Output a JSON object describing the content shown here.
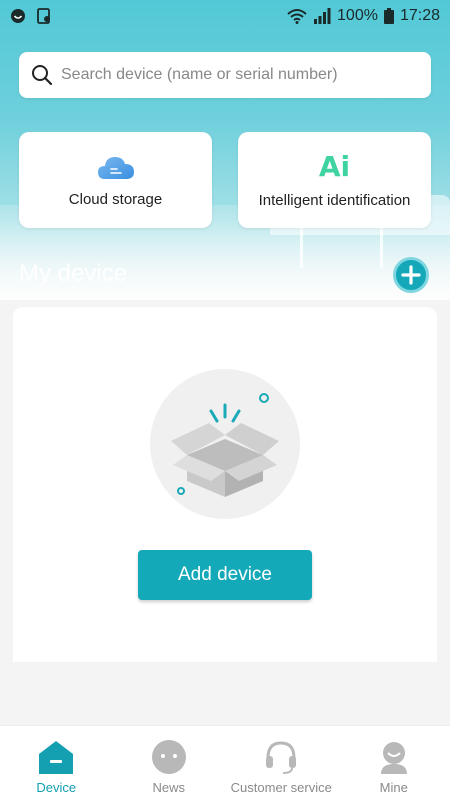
{
  "status_bar": {
    "battery": "100%",
    "time": "17:28",
    "icons": [
      "app-icon",
      "screenshot-icon",
      "wifi-icon",
      "signal-icon",
      "battery-icon"
    ]
  },
  "search": {
    "placeholder": "Search device (name or serial number)",
    "icon": "search-icon"
  },
  "features": [
    {
      "label": "Cloud storage",
      "icon": "cloud-icon"
    },
    {
      "label": "Intelligent identification",
      "icon": "ai-icon",
      "glyph": "Ai"
    }
  ],
  "my_device": {
    "title": "My device",
    "add_icon": "plus-icon",
    "empty_icon": "empty-box-icon",
    "add_button_label": "Add device"
  },
  "bottom_nav": [
    {
      "label": "Device",
      "icon": "home-icon",
      "active": true
    },
    {
      "label": "News",
      "icon": "chat-icon",
      "active": false
    },
    {
      "label": "Customer service",
      "icon": "headset-icon",
      "active": false
    },
    {
      "label": "Mine",
      "icon": "profile-icon",
      "active": false
    }
  ],
  "colors": {
    "accent": "#14a9b9",
    "hero_top": "#52c8d6",
    "ai_green": "#3fd3a2",
    "inactive_nav": "#8a8a8a"
  }
}
